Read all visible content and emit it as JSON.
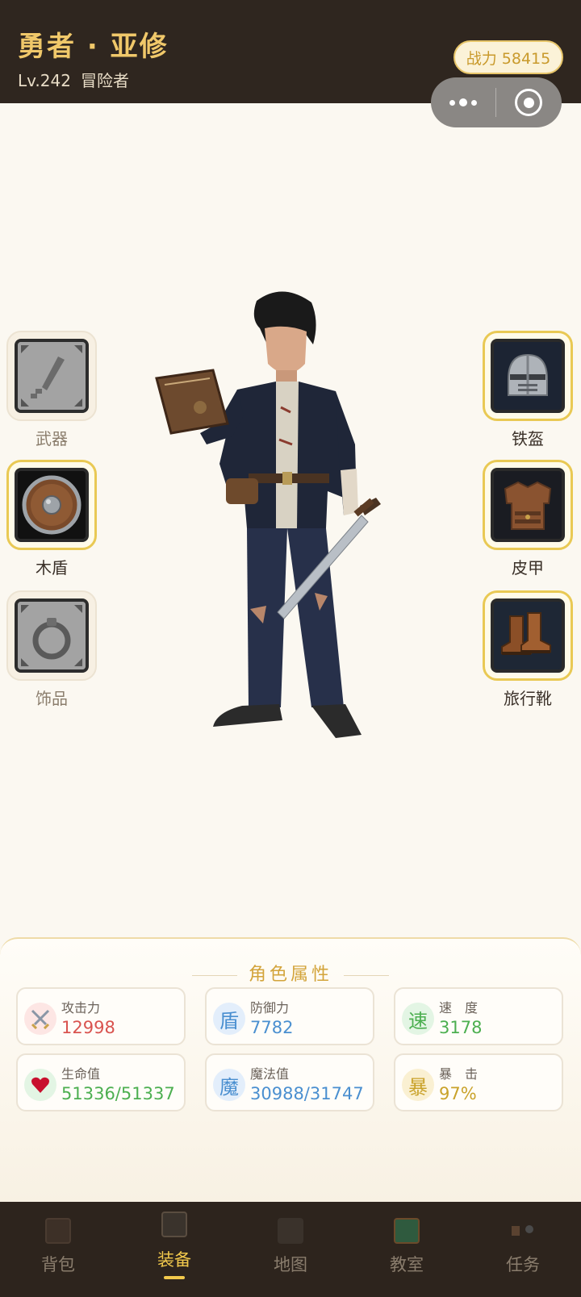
{
  "header": {
    "hero_name": "勇者 · 亚修",
    "level": "Lv.242",
    "class": "冒险者",
    "power": "战力 58415"
  },
  "slots": {
    "weapon": {
      "label": "武器",
      "equipped": false
    },
    "shield": {
      "label": "木盾",
      "equipped": true
    },
    "accessory": {
      "label": "饰品",
      "equipped": false
    },
    "helmet": {
      "label": "铁盔",
      "equipped": true
    },
    "armor": {
      "label": "皮甲",
      "equipped": true
    },
    "boots": {
      "label": "旅行靴",
      "equipped": true
    }
  },
  "stats": {
    "title": "角色属性",
    "attack": {
      "label": "攻击力",
      "value": "12998",
      "color": "#d9534f"
    },
    "defense": {
      "label": "防御力",
      "icon_char": "盾",
      "value": "7782",
      "color": "#4a8fd0"
    },
    "speed": {
      "label": "速　度",
      "icon_char": "速",
      "value": "3178",
      "color": "#4caf50"
    },
    "hp": {
      "label": "生命值",
      "value": "51336/51337",
      "color": "#4caf50"
    },
    "mp": {
      "label": "魔法值",
      "icon_char": "魔",
      "value": "30988/31747",
      "color": "#4a8fd0"
    },
    "crit": {
      "label": "暴　击",
      "icon_char": "暴",
      "value": "97%",
      "color": "#c9a22a"
    }
  },
  "nav": {
    "items": [
      {
        "label": "背包"
      },
      {
        "label": "装备"
      },
      {
        "label": "地图"
      },
      {
        "label": "教室"
      },
      {
        "label": "任务"
      }
    ],
    "active_index": 1
  },
  "colors": {
    "accent": "#f2c94c",
    "header_bg": "#2f261f",
    "page_bg": "#fbf8f1"
  }
}
